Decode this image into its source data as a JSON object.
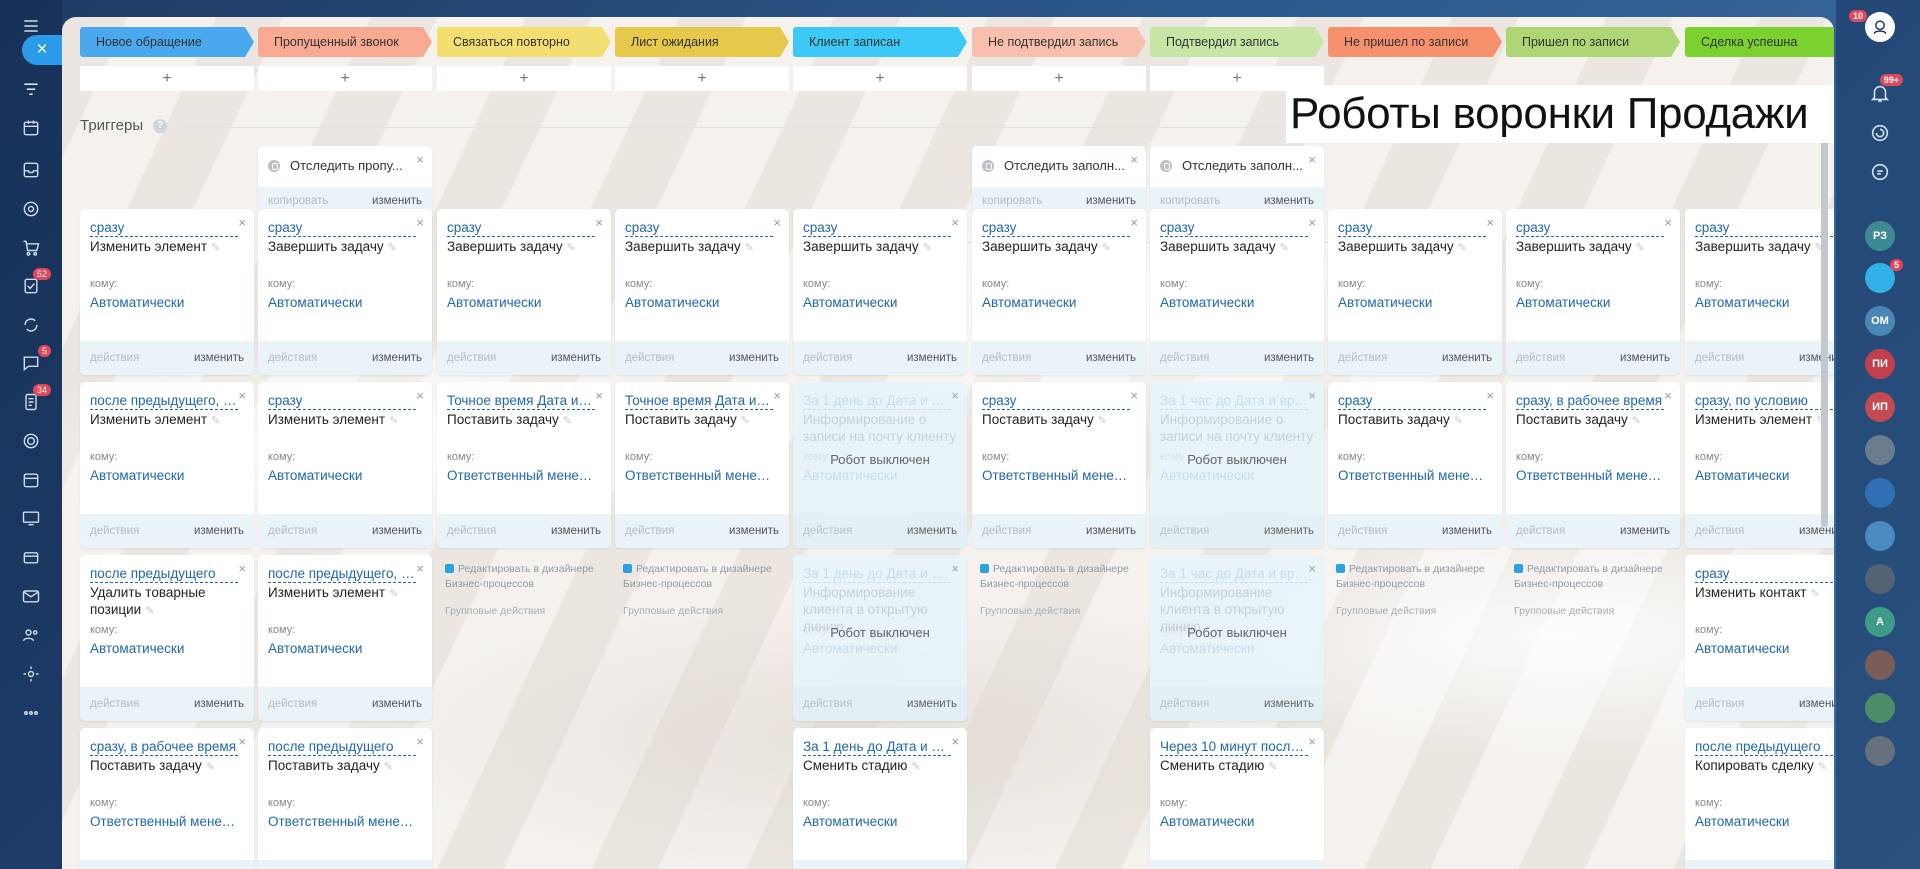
{
  "overlay_title": "Роботы воронки Продажи",
  "stages": [
    {
      "name": "Новое обращение",
      "color": "#4aa8ef",
      "dark": false
    },
    {
      "name": "Пропущенный звонок",
      "color": "#f7a992",
      "dark": false
    },
    {
      "name": "Связаться повторно",
      "color": "#f3df71",
      "dark": false
    },
    {
      "name": "Лист ожидания",
      "color": "#e6c84a",
      "dark": false
    },
    {
      "name": "Клиент записан",
      "color": "#3dc9f7",
      "dark": false
    },
    {
      "name": "Не подтвердил запись",
      "color": "#f8bfae",
      "dark": false
    },
    {
      "name": "Подтвердил запись",
      "color": "#c7e5a4",
      "dark": false
    },
    {
      "name": "Не пришел по записи",
      "color": "#f7916d",
      "dark": false
    },
    {
      "name": "Пришел по записи",
      "color": "#aed675",
      "dark": false
    },
    {
      "name": "Сделка успешна",
      "color": "#7bd12d",
      "dark": false
    }
  ],
  "add_symbol": "+",
  "sections": {
    "triggers": "Триггеры",
    "robots": "Роботы",
    "help": "?"
  },
  "ui": {
    "copy": "копировать",
    "change": "изменить",
    "actions": "действия",
    "whom": "кому:",
    "robot_off": "Робот выключен",
    "close": "×",
    "pen": "✎",
    "close_slider": "×"
  },
  "triggers": [
    {
      "col": 1,
      "title": "Отследить пропу..."
    },
    {
      "col": 5,
      "title": "Отследить заполн..."
    },
    {
      "col": 6,
      "title": "Отследить заполн..."
    }
  ],
  "robots": [
    {
      "col": 0,
      "row": 0,
      "cond": "сразу",
      "action": "Изменить элемент",
      "who": "Автоматически"
    },
    {
      "col": 1,
      "row": 0,
      "cond": "сразу",
      "action": "Завершить задачу",
      "who": "Автоматически"
    },
    {
      "col": 2,
      "row": 0,
      "cond": "сразу",
      "action": "Завершить задачу",
      "who": "Автоматически"
    },
    {
      "col": 3,
      "row": 0,
      "cond": "сразу",
      "action": "Завершить задачу",
      "who": "Автоматически"
    },
    {
      "col": 4,
      "row": 0,
      "cond": "сразу",
      "action": "Завершить задачу",
      "who": "Автоматически"
    },
    {
      "col": 5,
      "row": 0,
      "cond": "сразу",
      "action": "Завершить задачу",
      "who": "Автоматически"
    },
    {
      "col": 6,
      "row": 0,
      "cond": "сразу",
      "action": "Завершить задачу",
      "who": "Автоматически"
    },
    {
      "col": 7,
      "row": 0,
      "cond": "сразу",
      "action": "Завершить задачу",
      "who": "Автоматически"
    },
    {
      "col": 8,
      "row": 0,
      "cond": "сразу",
      "action": "Завершить задачу",
      "who": "Автоматически"
    },
    {
      "col": 9,
      "row": 0,
      "cond": "сразу",
      "action": "Завершить задачу",
      "who": "Автоматически"
    },
    {
      "col": 0,
      "row": 1,
      "cond": "после предыдущего, по условию",
      "action": "Изменить элемент",
      "who": "Автоматически"
    },
    {
      "col": 1,
      "row": 1,
      "cond": "сразу",
      "action": "Изменить элемент",
      "who": "Автоматически"
    },
    {
      "col": 2,
      "row": 1,
      "cond": "Точное время Дата и время",
      "action": "Поставить задачу",
      "who": "Ответственный менеджер"
    },
    {
      "col": 3,
      "row": 1,
      "cond": "Точное время Дата и время",
      "action": "Поставить задачу",
      "who": "Ответственный менеджер"
    },
    {
      "col": 4,
      "row": 1,
      "cond": "За 1 день до Дата и время",
      "action": "Информирование о записи на почту клиенту",
      "who": "Автоматически",
      "off": true
    },
    {
      "col": 5,
      "row": 1,
      "cond": "сразу",
      "action": "Поставить задачу",
      "who": "Ответственный менеджер"
    },
    {
      "col": 6,
      "row": 1,
      "cond": "За 1 час до Дата и время",
      "action": "Информирование о записи на почту клиенту",
      "who": "Автоматически",
      "off": true
    },
    {
      "col": 7,
      "row": 1,
      "cond": "сразу",
      "action": "Поставить задачу",
      "who": "Ответственный менеджер"
    },
    {
      "col": 8,
      "row": 1,
      "cond": "сразу, в рабочее время",
      "action": "Поставить задачу",
      "who": "Ответственный менеджер"
    },
    {
      "col": 9,
      "row": 1,
      "cond": "сразу, по условию",
      "action": "Изменить элемент",
      "who": "Автоматически"
    },
    {
      "col": 0,
      "row": 2,
      "cond": "после предыдущего",
      "action": "Удалить товарные позиции",
      "who": "Автоматически"
    },
    {
      "col": 1,
      "row": 2,
      "cond": "после предыдущего, по условию",
      "action": "Изменить элемент",
      "who": "Автоматически"
    },
    {
      "col": 4,
      "row": 2,
      "cond": "За 1 день до Дата и время",
      "action": "Информирование клиента в открытую линию",
      "who": "Автоматически",
      "off": true
    },
    {
      "col": 6,
      "row": 2,
      "cond": "За 1 час до Дата и время",
      "action": "Информирование клиента в открытую линию",
      "who": "Автоматически",
      "off": true
    },
    {
      "col": 9,
      "row": 2,
      "cond": "сразу",
      "action": "Изменить контакт",
      "who": "Автоматически"
    },
    {
      "col": 0,
      "row": 3,
      "cond": "сразу, в рабочее время",
      "action": "Поставить задачу",
      "who": "Ответственный менеджер"
    },
    {
      "col": 1,
      "row": 3,
      "cond": "после предыдущего",
      "action": "Поставить задачу",
      "who": "Ответственный менеджер"
    },
    {
      "col": 4,
      "row": 3,
      "cond": "За 1 день до Дата и время",
      "action": "Сменить стадию",
      "who": "Автоматически"
    },
    {
      "col": 6,
      "row": 3,
      "cond": "Через 10 минут после создания",
      "action": "Сменить стадию",
      "who": "Автоматически"
    },
    {
      "col": 9,
      "row": 3,
      "cond": "после предыдущего",
      "action": "Копировать сделку",
      "who": "Автоматически"
    }
  ],
  "group_cards": [
    {
      "col": 2,
      "row": 2,
      "line1": "Редактировать в дизайнере Бизнес-процессов",
      "line2": "Групповые действия"
    },
    {
      "col": 3,
      "row": 2,
      "line1": "Редактировать в дизайнере Бизнес-процессов",
      "line2": "Групповые действия"
    },
    {
      "col": 5,
      "row": 2,
      "line1": "Редактировать в дизайнере Бизнес-процессов",
      "line2": "Групповые действия"
    },
    {
      "col": 7,
      "row": 2,
      "line1": "Редактировать в дизайнере Бизнес-процессов",
      "line2": "Групповые действия"
    },
    {
      "col": 8,
      "row": 2,
      "line1": "Редактировать в дизайнере Бизнес-процессов",
      "line2": "Групповые действия"
    }
  ],
  "left_nav": [
    {
      "name": "menu-icon"
    },
    {
      "name": "funnel-icon",
      "active": true
    },
    {
      "name": "calendar-icon"
    },
    {
      "name": "inbox-icon"
    },
    {
      "name": "target-icon"
    },
    {
      "name": "cart-icon"
    },
    {
      "name": "tasks-icon",
      "badge": "52"
    },
    {
      "name": "sync-icon"
    },
    {
      "name": "chat-icon",
      "badge": "5"
    },
    {
      "name": "docs-icon",
      "badge": "34"
    },
    {
      "name": "circle-icon"
    },
    {
      "name": "planner-icon"
    },
    {
      "name": "monitor-icon"
    },
    {
      "name": "box-icon"
    },
    {
      "name": "mail-icon"
    },
    {
      "name": "users-icon"
    },
    {
      "name": "settings-icon"
    },
    {
      "name": "more-icon"
    }
  ],
  "right_nav": [
    {
      "type": "icon",
      "name": "bell-icon",
      "badge": "99+"
    },
    {
      "type": "icon",
      "name": "spiral-icon"
    },
    {
      "type": "icon",
      "name": "chat-bubble-icon"
    },
    {
      "type": "avatar",
      "label": "РЗ",
      "color": "#3d8a93"
    },
    {
      "type": "avatar",
      "label": "",
      "color": "#32b0e8",
      "badge": "5"
    },
    {
      "type": "avatar",
      "label": "ОМ",
      "color": "#4a87b6"
    },
    {
      "type": "avatar",
      "label": "ПИ",
      "color": "#c0414c"
    },
    {
      "type": "avatar",
      "label": "ИП",
      "color": "#c44a52"
    },
    {
      "type": "avatar",
      "label": "",
      "color": "#6a7d8f"
    },
    {
      "type": "avatar",
      "label": "",
      "color": "#2f6fb5"
    },
    {
      "type": "avatar",
      "label": "",
      "color": "#4a8bc3"
    },
    {
      "type": "avatar",
      "label": "",
      "color": "#546373"
    },
    {
      "type": "avatar",
      "label": "А",
      "color": "#3e9b88"
    },
    {
      "type": "avatar",
      "label": "",
      "color": "#7a5d58"
    },
    {
      "type": "avatar",
      "label": "",
      "color": "#4e8d6a"
    },
    {
      "type": "avatar",
      "label": "",
      "color": "#66717d"
    }
  ],
  "top_right_badge": "10"
}
